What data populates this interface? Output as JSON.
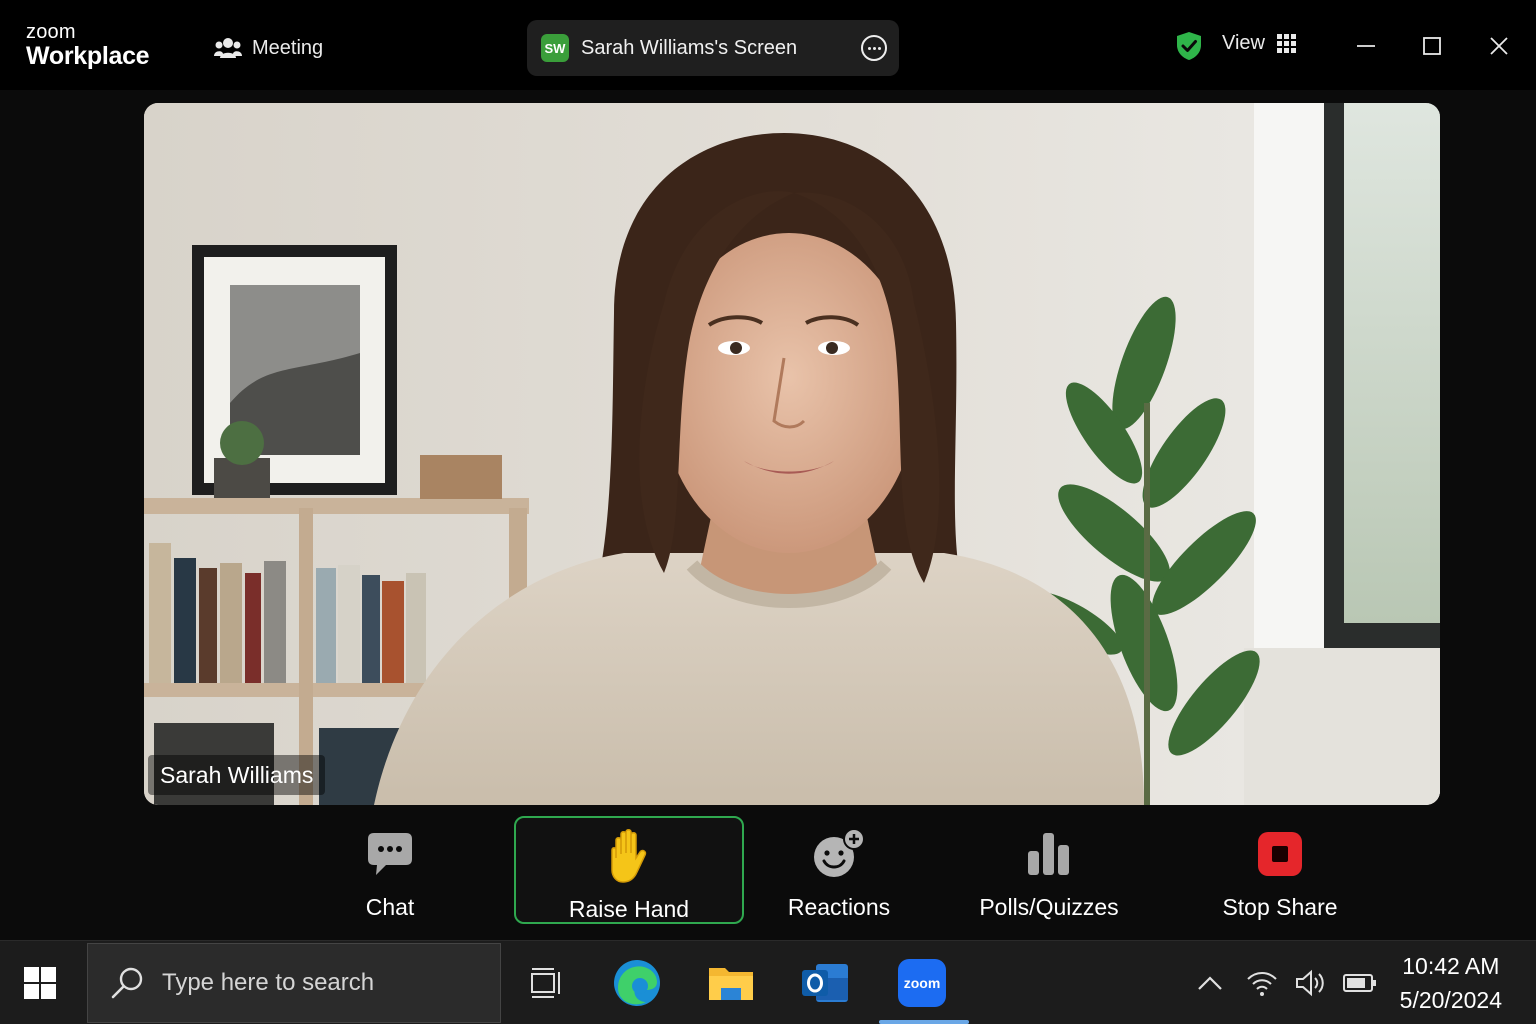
{
  "window": {
    "brand_top": "zoom",
    "brand_bottom": "Workplace",
    "meeting_label": "Meeting",
    "share_avatar": "SW",
    "share_title": "Sarah Williams's Screen",
    "view_label": "View",
    "security_color": "#2fb54a"
  },
  "video": {
    "participant_name": "Sarah Williams"
  },
  "toolbar": {
    "items": [
      {
        "label": "Chat",
        "icon": "chat-bubble-icon"
      },
      {
        "label": "Raise Hand",
        "icon": "raise-hand-icon",
        "active": true
      },
      {
        "label": "Reactions",
        "icon": "reactions-icon"
      },
      {
        "label": "Polls/Quizzes",
        "icon": "polls-icon"
      },
      {
        "label": "Stop Share",
        "icon": "stop-share-icon",
        "color": "#e5262b"
      }
    ]
  },
  "taskbar": {
    "search_placeholder": "Type here to search",
    "apps": [
      "task-view-icon",
      "edge-icon",
      "file-explorer-icon",
      "outlook-icon",
      "zoom-icon"
    ],
    "zoom_app_label": "zoom",
    "time": "10:42 AM",
    "date": "5/20/2024"
  }
}
